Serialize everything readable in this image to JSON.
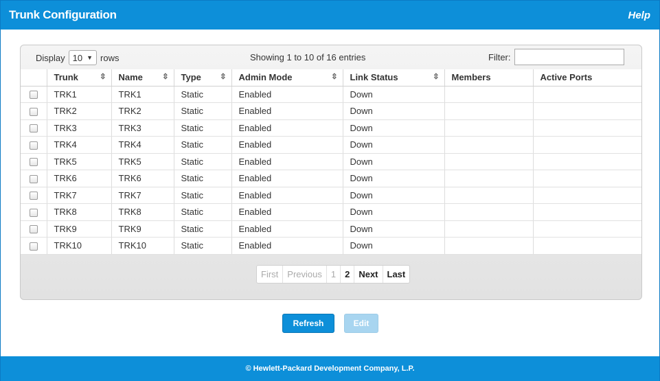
{
  "header": {
    "title": "Trunk Configuration",
    "help": "Help"
  },
  "grid": {
    "display_label": "Display",
    "page_size": "10",
    "rows_label": "rows",
    "showing_text": "Showing 1 to 10 of 16 entries",
    "filter_label": "Filter:",
    "filter_value": "",
    "columns": [
      "Trunk",
      "Name",
      "Type",
      "Admin Mode",
      "Link Status",
      "Members",
      "Active Ports"
    ],
    "rows": [
      [
        "TRK1",
        "TRK1",
        "Static",
        "Enabled",
        "Down",
        "",
        ""
      ],
      [
        "TRK2",
        "TRK2",
        "Static",
        "Enabled",
        "Down",
        "",
        ""
      ],
      [
        "TRK3",
        "TRK3",
        "Static",
        "Enabled",
        "Down",
        "",
        ""
      ],
      [
        "TRK4",
        "TRK4",
        "Static",
        "Enabled",
        "Down",
        "",
        ""
      ],
      [
        "TRK5",
        "TRK5",
        "Static",
        "Enabled",
        "Down",
        "",
        ""
      ],
      [
        "TRK6",
        "TRK6",
        "Static",
        "Enabled",
        "Down",
        "",
        ""
      ],
      [
        "TRK7",
        "TRK7",
        "Static",
        "Enabled",
        "Down",
        "",
        ""
      ],
      [
        "TRK8",
        "TRK8",
        "Static",
        "Enabled",
        "Down",
        "",
        ""
      ],
      [
        "TRK9",
        "TRK9",
        "Static",
        "Enabled",
        "Down",
        "",
        ""
      ],
      [
        "TRK10",
        "TRK10",
        "Static",
        "Enabled",
        "Down",
        "",
        ""
      ]
    ]
  },
  "pagination": {
    "first": "First",
    "previous": "Previous",
    "pages": [
      "1",
      "2"
    ],
    "next": "Next",
    "last": "Last"
  },
  "buttons": {
    "refresh": "Refresh",
    "edit": "Edit"
  },
  "footer": {
    "text": "© Hewlett-Packard Development Company, L.P."
  },
  "colors": {
    "brand": "#0d8fd9",
    "edit_disabled": "#a8d5f0"
  }
}
